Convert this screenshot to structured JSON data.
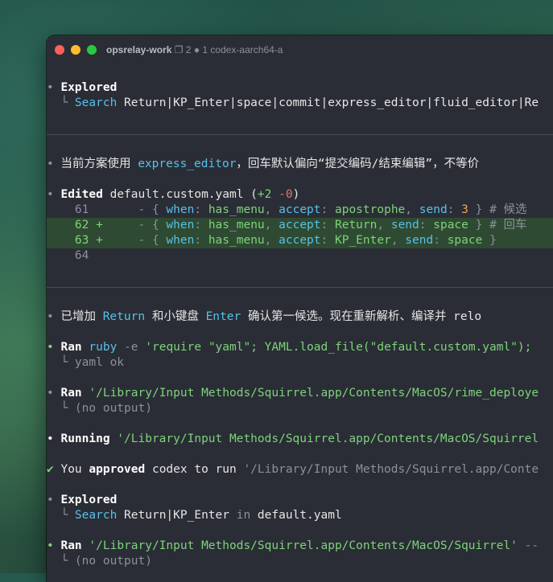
{
  "window": {
    "title": "opsrelay-work",
    "tab_info": "❐ 2 ● 1 codex-aarch64-a"
  },
  "lines": {
    "explored1": "Explored",
    "search1_label": "Search",
    "search1_args": " Return|KP_Enter|space|commit|express_editor|fluid_editor|Re",
    "cn1_a": "当前方案使用 ",
    "cn1_code": "express_editor",
    "cn1_b": "，回车默认偏向“提交编码/结束编辑”，不等价",
    "edited_label": "Edited",
    "edited_file": " default.custom.yaml (",
    "edited_plus": "+2",
    "edited_minus": " -0",
    "edited_close": ")",
    "d61_num": "61",
    "d61_pre": "       - { ",
    "d61_when": "when",
    "d61_c1": ": ",
    "d61_menu": "has_menu",
    "d61_c2": ", ",
    "d61_accept": "accept",
    "d61_c3": ": ",
    "d61_aval": "apostrophe",
    "d61_c4": ", ",
    "d61_send": "send",
    "d61_c5": ": ",
    "d61_sval": "3",
    "d61_post": " } # 候选",
    "d62_num": "62 +",
    "d62_pre": "     - { ",
    "d62_when": "when",
    "d62_menu": "has_menu",
    "d62_accept": "accept",
    "d62_aval": "Return",
    "d62_send": "send",
    "d62_sval": "space",
    "d62_post": " } # 回车",
    "d63_num": "63 +",
    "d63_pre": "     - { ",
    "d63_when": "when",
    "d63_menu": "has_menu",
    "d63_accept": "accept",
    "d63_aval": "KP_Enter",
    "d63_send": "send",
    "d63_sval": "space",
    "d63_post": " }",
    "d64_num": "64",
    "cn2_a": "已增加 ",
    "cn2_return": "Return",
    "cn2_b": " 和小键盘 ",
    "cn2_enter": "Enter",
    "cn2_c": " 确认第一候选。现在重新解析、编译并 relo",
    "ran1_label": "Ran",
    "ran1_cmd": "ruby",
    "ran1_flag": " -e",
    "ran1_str": " 'require \"yaml\"; YAML.load_file(\"default.custom.yaml\");",
    "ran1_out": "yaml ok",
    "ran2_label": "Ran",
    "ran2_cmd": " '/Library/Input Methods/Squirrel.app/Contents/MacOS/rime_deploye",
    "ran2_out": "(no output)",
    "running_label": "Running",
    "running_cmd": " '/Library/Input Methods/Squirrel.app/Contents/MacOS/Squirrel",
    "approved_check": "✔",
    "approved_you": " You ",
    "approved_word": "approved",
    "approved_rest": " codex to run ",
    "approved_cmd": "'/Library/Input Methods/Squirrel.app/Conte",
    "explored2": "Explored",
    "search2_label": "Search",
    "search2_args": " Return|KP_Enter",
    "search2_in": " in",
    "search2_file": " default.yaml",
    "ran3_label": "Ran",
    "ran3_cmd": " '/Library/Input Methods/Squirrel.app/Contents/MacOS/Squirrel'",
    "ran3_tail": " --",
    "ran3_out": "(no output)"
  }
}
